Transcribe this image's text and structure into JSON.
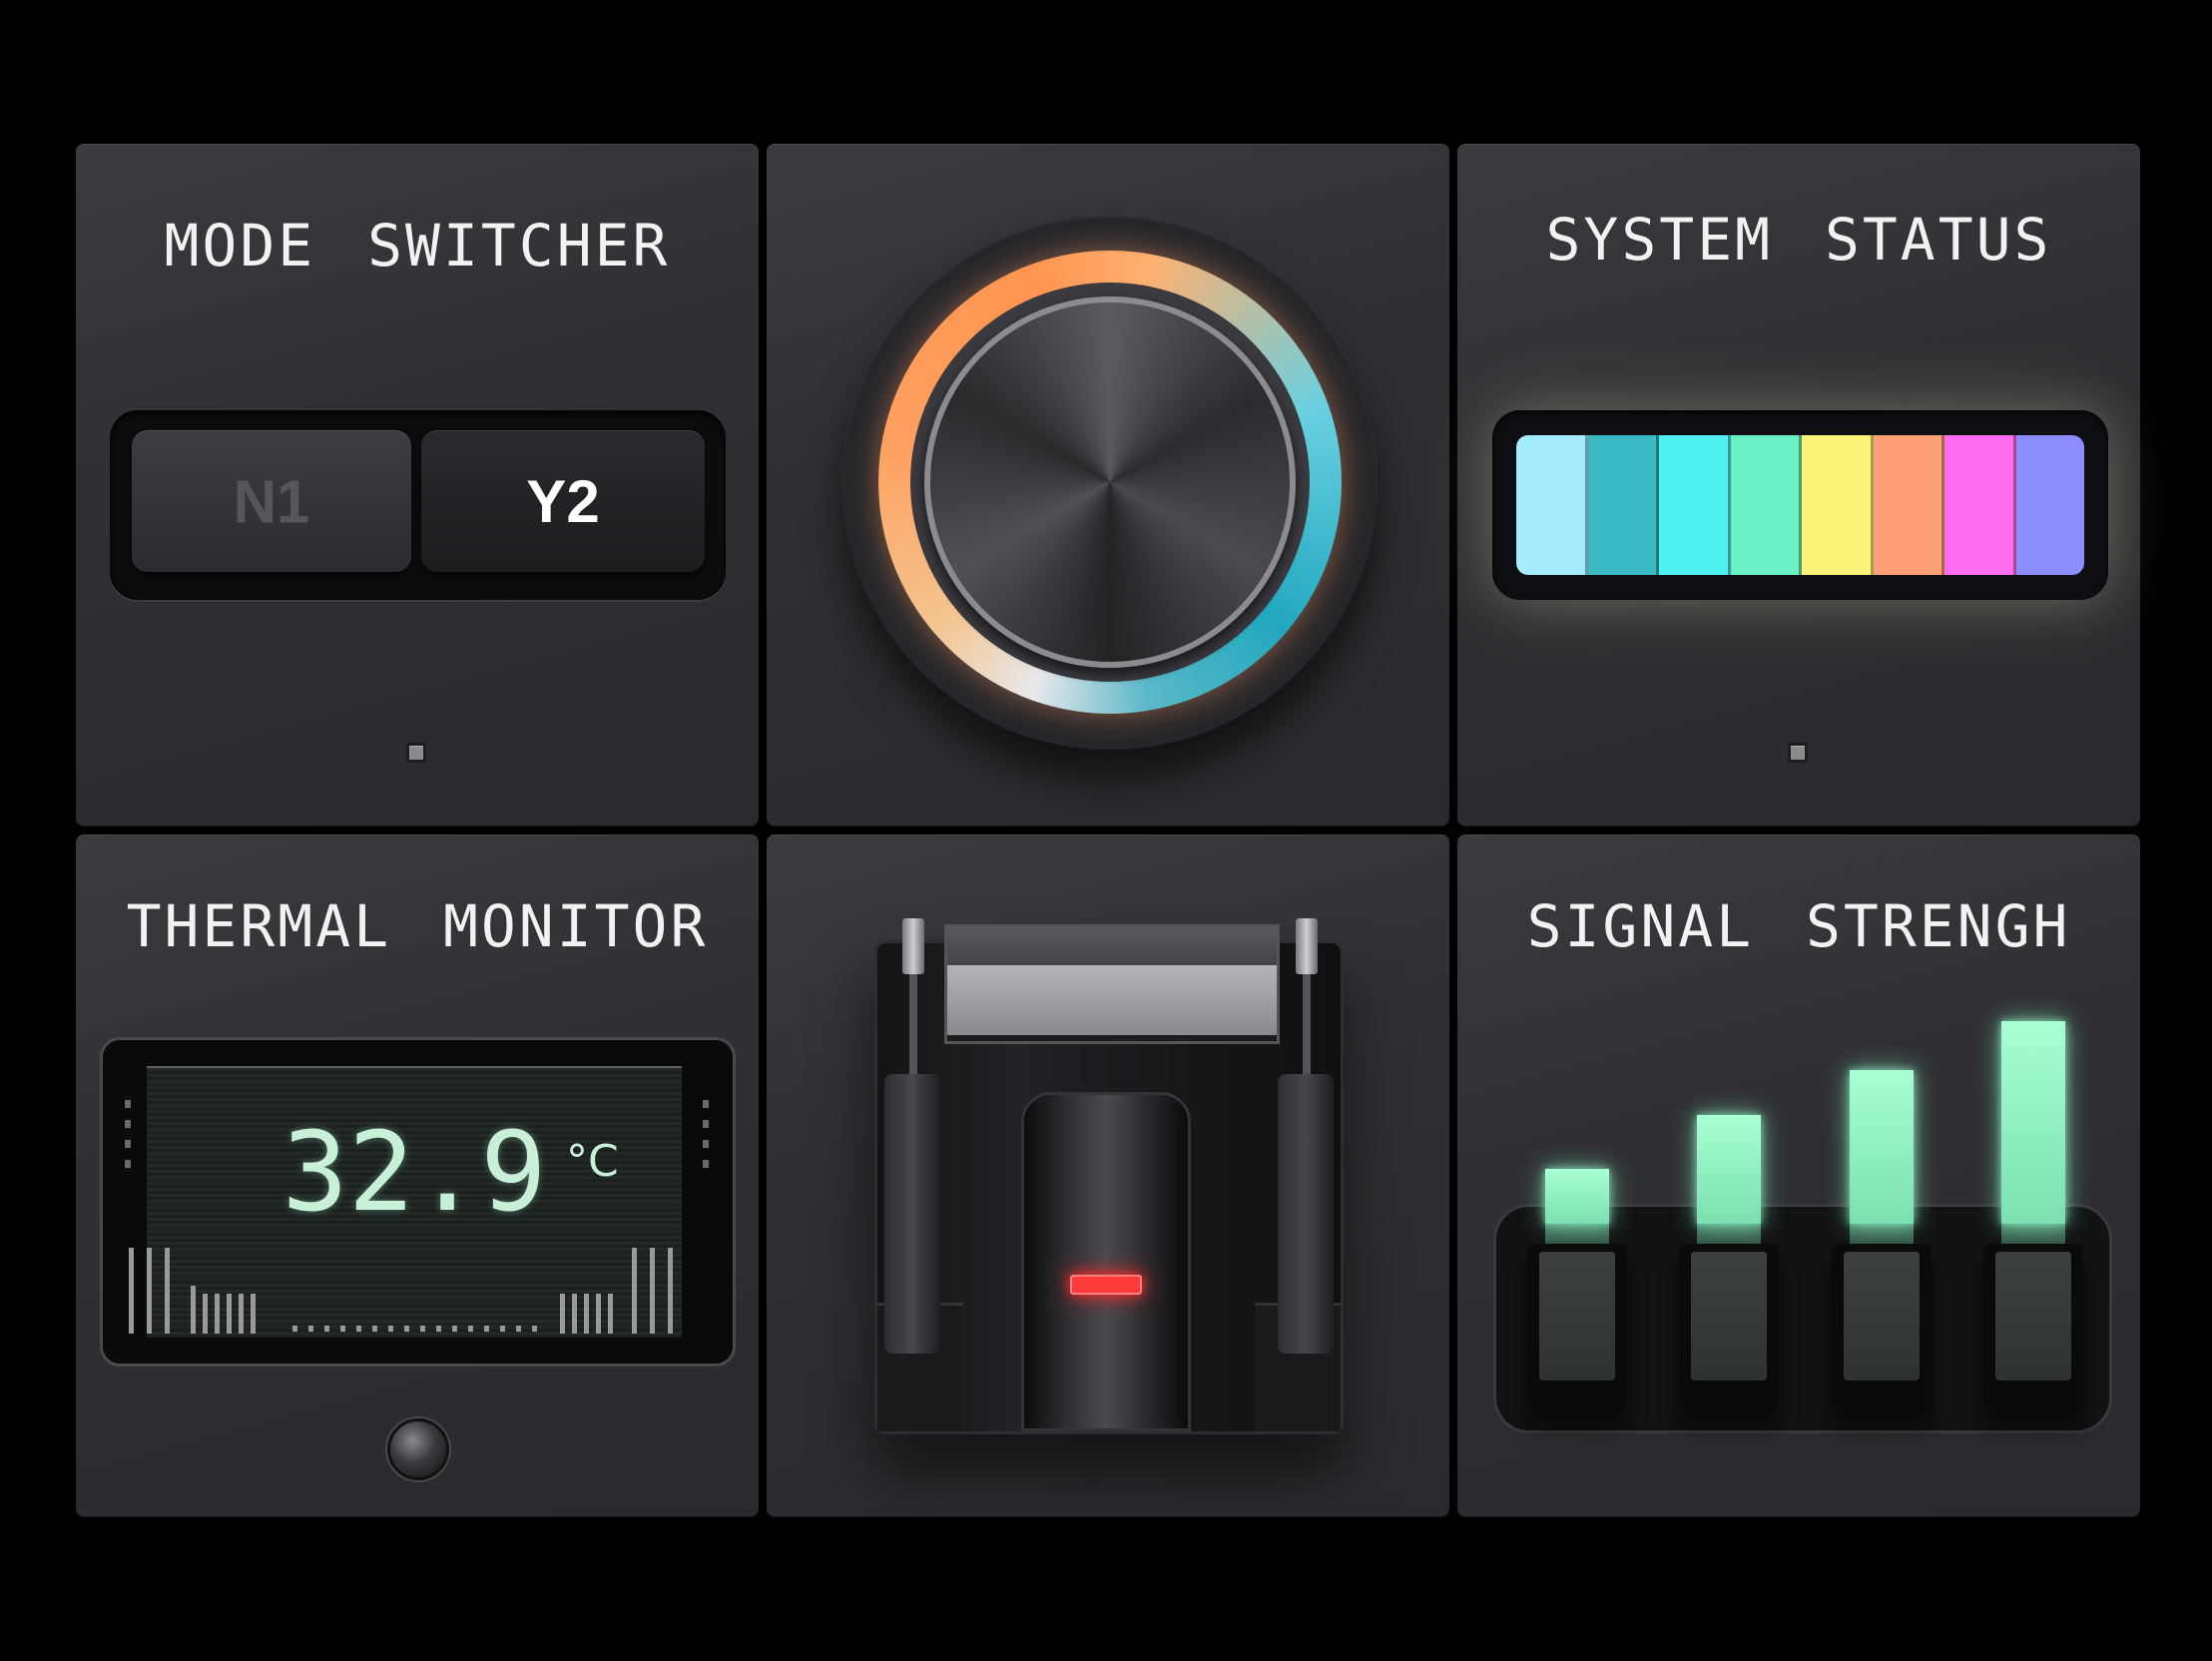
{
  "mode_switcher": {
    "title": "MODE SWITCHER",
    "options": [
      "N1",
      "Y2"
    ],
    "selected": "Y2"
  },
  "rotary_knob": {
    "ring_colors": [
      "#ffa060",
      "#22a8c0"
    ]
  },
  "system_status": {
    "title": "SYSTEM STATUS",
    "segments": [
      "#a6ecff",
      "#3bb9c5",
      "#4ff0ef",
      "#6bf0c8",
      "#fcf57a",
      "#ffa076",
      "#ff6ef0",
      "#8c8cff"
    ]
  },
  "thermal_monitor": {
    "title": "THERMAL MONITOR",
    "value": "32.9",
    "unit": "°C",
    "display_color": "#c8f0d8"
  },
  "lever_switch": {
    "led_color": "#ff3b3b"
  },
  "signal_strength": {
    "title": "SIGNAL STRENGH",
    "levels": [
      0.35,
      0.55,
      0.72,
      0.9
    ],
    "bar_color": "#8ef0c0"
  }
}
